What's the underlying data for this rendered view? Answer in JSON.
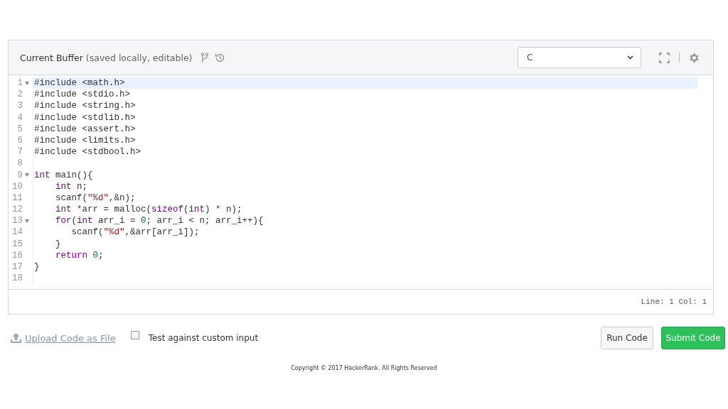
{
  "header": {
    "title": "Current Buffer",
    "subtitle": "(saved locally, editable)",
    "language": "C"
  },
  "lines": [
    {
      "number": "1",
      "fold": true,
      "active": true,
      "tokens": [
        {
          "text": "#include <math.h>",
          "kind": "plain"
        }
      ]
    },
    {
      "number": "2",
      "fold": false,
      "active": false,
      "tokens": [
        {
          "text": "#include <stdio.h>",
          "kind": "plain"
        }
      ]
    },
    {
      "number": "3",
      "fold": false,
      "active": false,
      "tokens": [
        {
          "text": "#include <string.h>",
          "kind": "plain"
        }
      ]
    },
    {
      "number": "4",
      "fold": false,
      "active": false,
      "tokens": [
        {
          "text": "#include <stdlib.h>",
          "kind": "plain"
        }
      ]
    },
    {
      "number": "5",
      "fold": false,
      "active": false,
      "tokens": [
        {
          "text": "#include <assert.h>",
          "kind": "plain"
        }
      ]
    },
    {
      "number": "6",
      "fold": false,
      "active": false,
      "tokens": [
        {
          "text": "#include <limits.h>",
          "kind": "plain"
        }
      ]
    },
    {
      "number": "7",
      "fold": false,
      "active": false,
      "tokens": [
        {
          "text": "#include <stdbool.h>",
          "kind": "plain"
        }
      ]
    },
    {
      "number": "8",
      "fold": false,
      "active": false
    },
    {
      "number": "9",
      "fold": true,
      "active": false,
      "tokens": [
        {
          "text": "int",
          "kind": "keyword"
        },
        {
          "text": " main(){",
          "kind": "plain"
        }
      ]
    },
    {
      "number": "10",
      "fold": false,
      "active": false,
      "tokens": [
        {
          "text": "    int",
          "kind": "keyword"
        },
        {
          "text": " n;",
          "kind": "plain"
        }
      ]
    },
    {
      "number": "11",
      "fold": false,
      "active": false,
      "tokens": [
        {
          "text": "    scanf(",
          "kind": "plain"
        },
        {
          "text": "\"%d\"",
          "kind": "string"
        },
        {
          "text": ",&n);",
          "kind": "plain"
        }
      ]
    },
    {
      "number": "12",
      "fold": false,
      "active": false,
      "tokens": [
        {
          "text": "    int",
          "kind": "keyword"
        },
        {
          "text": " *arr = malloc(",
          "kind": "plain"
        },
        {
          "text": "sizeof",
          "kind": "keyword"
        },
        {
          "text": "(",
          "kind": "plain"
        },
        {
          "text": "int",
          "kind": "keyword"
        },
        {
          "text": ") * n);",
          "kind": "plain"
        }
      ]
    },
    {
      "number": "13",
      "fold": true,
      "active": false,
      "tokens": [
        {
          "text": "    for",
          "kind": "keyword"
        },
        {
          "text": "(",
          "kind": "plain"
        },
        {
          "text": "int",
          "kind": "keyword"
        },
        {
          "text": " arr_i = ",
          "kind": "plain"
        },
        {
          "text": "0",
          "kind": "number"
        },
        {
          "text": "; arr_i < n; arr_i++){",
          "kind": "plain"
        }
      ]
    },
    {
      "number": "14",
      "fold": false,
      "active": false,
      "tokens": [
        {
          "text": "       scanf(",
          "kind": "plain"
        },
        {
          "text": "\"%d\"",
          "kind": "string"
        },
        {
          "text": ",&arr[arr_i]);",
          "kind": "plain"
        }
      ]
    },
    {
      "number": "15",
      "fold": false,
      "active": false,
      "tokens": [
        {
          "text": "    }",
          "kind": "plain"
        }
      ]
    },
    {
      "number": "16",
      "fold": false,
      "active": false,
      "tokens": [
        {
          "text": "    return ",
          "kind": "keyword"
        },
        {
          "text": "0",
          "kind": "number"
        },
        {
          "text": ";",
          "kind": "plain"
        }
      ]
    },
    {
      "number": "17",
      "fold": false,
      "active": false,
      "tokens": [
        {
          "text": "}",
          "kind": "plain"
        }
      ]
    },
    {
      "number": "18",
      "fold": false,
      "active": false
    }
  ],
  "status": "Line: 1 Col: 1",
  "actions": {
    "upload": "Upload Code as File",
    "custom_input": {
      "label": "Test against custom input",
      "checked": false
    },
    "run": "Run Code",
    "submit": "Submit Code"
  },
  "footer": "Copyright © 2017 HackerRank. All Rights Reserved"
}
